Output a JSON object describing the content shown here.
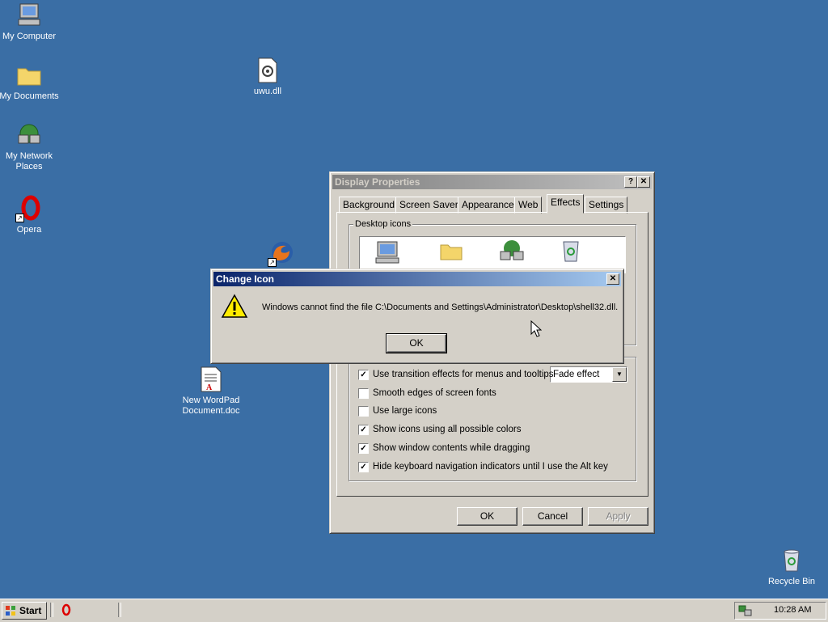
{
  "desktop": {
    "icons": [
      {
        "label": "My Computer",
        "icon": "my-computer-icon"
      },
      {
        "label": "My Documents",
        "icon": "folder-icon"
      },
      {
        "label": "My Network Places",
        "icon": "network-places-icon"
      },
      {
        "label": "Opera",
        "icon": "opera-icon"
      },
      {
        "label": "uwu.dll",
        "icon": "dll-file-icon"
      },
      {
        "label": "",
        "icon": "firefox-icon"
      },
      {
        "label": "New WordPad Document.doc",
        "icon": "wordpad-document-icon"
      },
      {
        "label": "Recycle Bin",
        "icon": "recycle-bin-icon"
      }
    ]
  },
  "display_properties": {
    "title": "Display Properties",
    "tabs": [
      "Background",
      "Screen Saver",
      "Appearance",
      "Web",
      "Effects",
      "Settings"
    ],
    "selected_tab": "Effects",
    "desktop_icons_group": "Desktop icons",
    "checkboxes": [
      {
        "label": "Use transition effects for menus and tooltips",
        "checked": true
      },
      {
        "label": "Smooth edges of screen fonts",
        "checked": false
      },
      {
        "label": "Use large icons",
        "checked": false
      },
      {
        "label": "Show icons using all possible colors",
        "checked": true
      },
      {
        "label": "Show window contents while dragging",
        "checked": true
      },
      {
        "label": "Hide keyboard navigation indicators until I use the Alt key",
        "checked": true
      }
    ],
    "transition_effect": "Fade effect",
    "ok_label": "OK",
    "cancel_label": "Cancel",
    "apply_label": "Apply"
  },
  "change_icon": {
    "title": "Change Icon",
    "message": "Windows cannot find the file C:\\Documents and Settings\\Administrator\\Desktop\\shell32.dll.",
    "ok_label": "OK"
  },
  "taskbar": {
    "start_label": "Start",
    "clock": "10:28 AM"
  }
}
